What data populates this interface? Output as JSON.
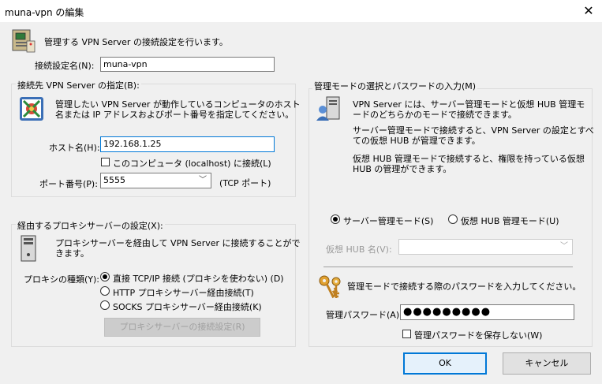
{
  "window": {
    "title": "muna-vpn の編集",
    "close_glyph": "✕"
  },
  "header": {
    "description": "管理する VPN Server の接続設定を行います。"
  },
  "connection_name": {
    "label": "接続設定名(N):",
    "value": "muna-vpn"
  },
  "server_group": {
    "legend": "接続先 VPN Server の指定(B):",
    "description_line1": "管理したい VPN Server が動作しているコンピュータのホスト",
    "description_line2": "名または IP アドレスおよびポート番号を指定してください。",
    "host_label": "ホスト名(H):",
    "host_value": "192.168.1.25",
    "localhost_label": "このコンピュータ (localhost) に接続(L)",
    "port_label": "ポート番号(P):",
    "port_value": "5555",
    "port_suffix": "(TCP ポート)"
  },
  "proxy_group": {
    "legend": "経由するプロキシサーバーの設定(X):",
    "description_line1": "プロキシサーバーを経由して VPN Server に接続することがで",
    "description_line2": "きます。",
    "type_label": "プロキシの種類(Y):",
    "options": [
      "直接 TCP/IP 接続 (プロキシを使わない) (D)",
      "HTTP プロキシサーバー経由接続(T)",
      "SOCKS プロキシサーバー経由接続(K)"
    ],
    "settings_button": "プロキシサーバーの接続設定(R)"
  },
  "admin_group": {
    "legend": "管理モードの選択とパスワードの入力(M)",
    "desc1_line1": "VPN Server には、サーバー管理モードと仮想 HUB 管理モ",
    "desc1_line2": "ードのどちらかのモードで接続できます。",
    "desc2_line1": "サーバー管理モードで接続すると、VPN Server の設定とすべ",
    "desc2_line2": "ての仮想 HUB が管理できます。",
    "desc3_line1": "仮想 HUB 管理モードで接続すると、権限を持っている仮想",
    "desc3_line2": "HUB の管理ができます。",
    "server_mode_label": "サーバー管理モード(S)",
    "hub_mode_label": "仮想 HUB 管理モード(U)",
    "hub_name_label": "仮想 HUB 名(V):",
    "password_prompt": "管理モードで接続する際のパスワードを入力してください。",
    "password_label": "管理パスワード(A):",
    "password_value": "●●●●●●●●●",
    "no_save_label": "管理パスワードを保存しない(W)"
  },
  "buttons": {
    "ok": "OK",
    "cancel": "キャンセル"
  }
}
